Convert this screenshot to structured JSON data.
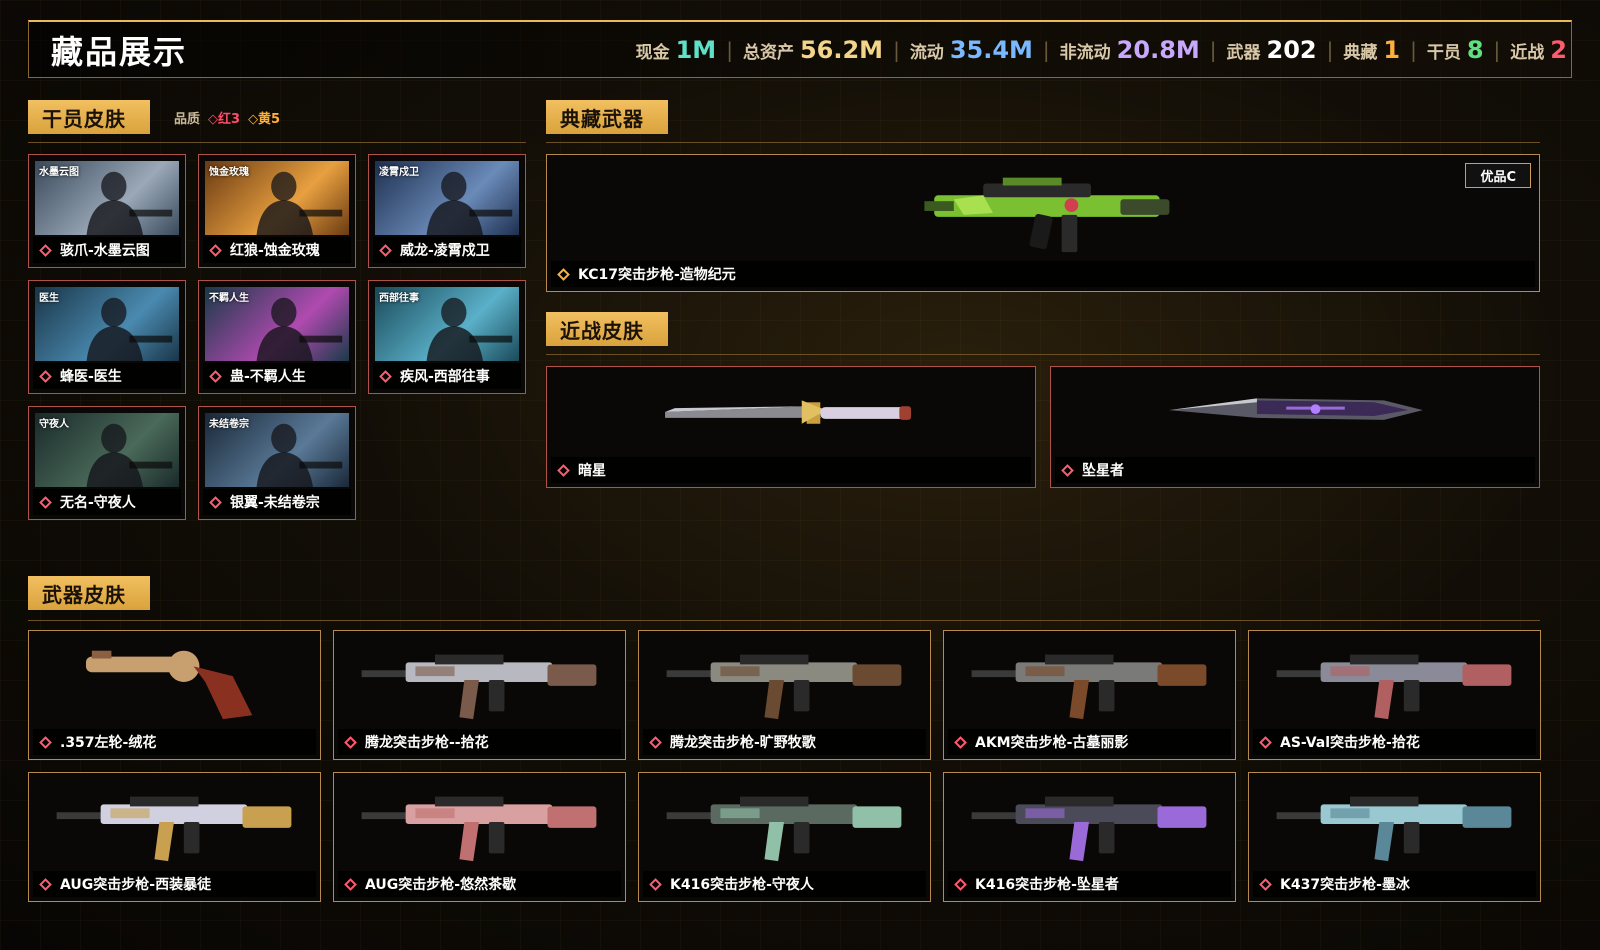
{
  "header": {
    "title": "藏品展示",
    "stats": [
      {
        "label": "现金",
        "value": "1M",
        "color": "#5fe0c8"
      },
      {
        "label": "总资产",
        "value": "56.2M",
        "color": "#f2d48a"
      },
      {
        "label": "流动",
        "value": "35.4M",
        "color": "#7ab8ff"
      },
      {
        "label": "非流动",
        "value": "20.8M",
        "color": "#c8a8ff"
      },
      {
        "label": "武器",
        "value": "202",
        "color": "#ffffff"
      },
      {
        "label": "典藏",
        "value": "1",
        "color": "#ffb03a"
      },
      {
        "label": "干员",
        "value": "8",
        "color": "#5fe080"
      },
      {
        "label": "近战",
        "value": "2",
        "color": "#ff5b6e"
      }
    ]
  },
  "operator_skins": {
    "title": "干员皮肤",
    "quality_label": "品质",
    "quality_red": "◇红3",
    "quality_yellow": "◇黄5",
    "items": [
      {
        "name": "骇爪-水墨云图",
        "tag": "水墨云图",
        "palette": [
          "#3a4a5a",
          "#9aa8b8"
        ]
      },
      {
        "name": "红狼-蚀金玫瑰",
        "tag": "蚀金玫瑰",
        "palette": [
          "#6a3a12",
          "#e8a040"
        ]
      },
      {
        "name": "威龙-凌霄戍卫",
        "tag": "凌霄戍卫",
        "palette": [
          "#1e3050",
          "#6a8ab8"
        ]
      },
      {
        "name": "蜂医-医生",
        "tag": "医生",
        "palette": [
          "#1a3548",
          "#4a8ab0"
        ]
      },
      {
        "name": "蛊-不羁人生",
        "tag": "不羁人生",
        "palette": [
          "#1a3a48",
          "#b04ab0"
        ]
      },
      {
        "name": "疾风-西部往事",
        "tag": "西部往事",
        "palette": [
          "#1a4a5a",
          "#5ab0c8"
        ]
      },
      {
        "name": "无名-守夜人",
        "tag": "守夜人",
        "palette": [
          "#1a2a2a",
          "#4a6a5a"
        ]
      },
      {
        "name": "银翼-未结卷宗",
        "tag": "未结卷宗",
        "palette": [
          "#1a2838",
          "#5a7a98"
        ]
      }
    ]
  },
  "collection_weapons": {
    "title": "典藏武器",
    "item": {
      "name": "KC17突击步枪-造物纪元",
      "grade": "优品C"
    }
  },
  "melee_skins": {
    "title": "近战皮肤",
    "items": [
      {
        "name": "暗星"
      },
      {
        "name": "坠星者"
      }
    ]
  },
  "weapon_skins": {
    "title": "武器皮肤",
    "items": [
      {
        "name": ".357左轮-绒花",
        "colors": [
          "#c8a070",
          "#8a3020"
        ]
      },
      {
        "name": "腾龙突击步枪--拾花",
        "colors": [
          "#b8b8c0",
          "#7a5a4a"
        ]
      },
      {
        "name": "腾龙突击步枪-旷野牧歌",
        "colors": [
          "#8a8a80",
          "#6a4a30"
        ]
      },
      {
        "name": "AKM突击步枪-古墓丽影",
        "colors": [
          "#7a7a78",
          "#7a4a2a"
        ]
      },
      {
        "name": "AS-Val突击步枪-拾花",
        "colors": [
          "#8a8a98",
          "#b06060"
        ]
      },
      {
        "name": "AUG突击步枪-西装暴徒",
        "colors": [
          "#d0d0e0",
          "#c8a050"
        ]
      },
      {
        "name": "AUG突击步枪-悠然茶歇",
        "colors": [
          "#d8a0a0",
          "#c07070"
        ]
      },
      {
        "name": "K416突击步枪-守夜人",
        "colors": [
          "#5a6a60",
          "#90c0a8"
        ]
      },
      {
        "name": "K416突击步枪-坠星者",
        "colors": [
          "#4a4a58",
          "#9a6ad8"
        ]
      },
      {
        "name": "K437突击步枪-墨冰",
        "colors": [
          "#9ac8d0",
          "#5a8898"
        ]
      }
    ]
  }
}
